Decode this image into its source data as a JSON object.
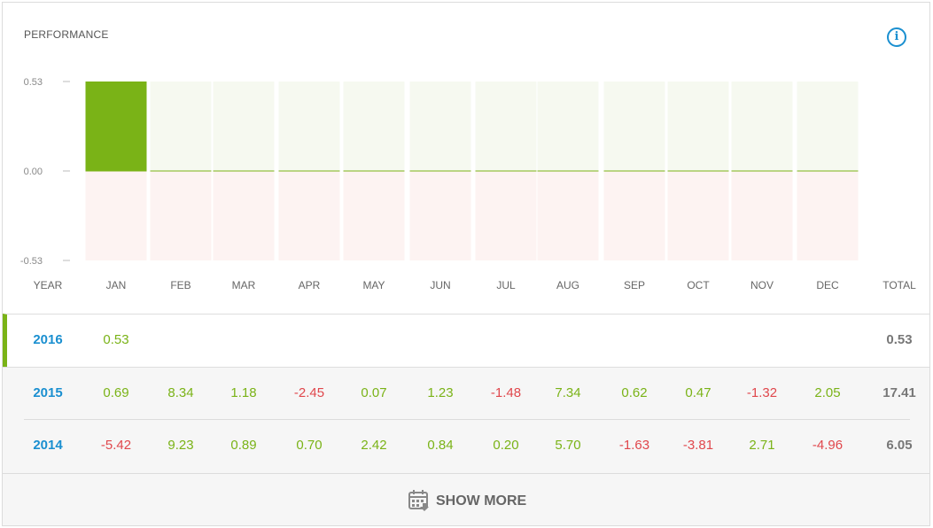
{
  "header": {
    "title": "PERFORMANCE",
    "info_icon": "info-icon"
  },
  "chart_data": {
    "type": "bar",
    "categories": [
      "JAN",
      "FEB",
      "MAR",
      "APR",
      "MAY",
      "JUN",
      "JUL",
      "AUG",
      "SEP",
      "OCT",
      "NOV",
      "DEC"
    ],
    "series": [
      {
        "values": [
          0.53,
          0,
          0,
          0,
          0,
          0,
          0,
          0,
          0,
          0,
          0,
          0
        ]
      }
    ],
    "ylim": [
      -0.53,
      0.53
    ],
    "yticks": [
      "0.53",
      "0.00",
      "-0.53"
    ],
    "colors": {
      "positive": "#7ab317",
      "positive_bg": "#f6f9f0",
      "negative_bg": "#fdf3f2"
    }
  },
  "table": {
    "columns": [
      "YEAR",
      "JAN",
      "FEB",
      "MAR",
      "APR",
      "MAY",
      "JUN",
      "JUL",
      "AUG",
      "SEP",
      "OCT",
      "NOV",
      "DEC",
      "TOTAL"
    ],
    "rows": [
      {
        "year": "2016",
        "months": [
          "0.53",
          "",
          "",
          "",
          "",
          "",
          "",
          "",
          "",
          "",
          "",
          ""
        ],
        "total": "0.53"
      },
      {
        "year": "2015",
        "months": [
          "0.69",
          "8.34",
          "1.18",
          "-2.45",
          "0.07",
          "1.23",
          "-1.48",
          "7.34",
          "0.62",
          "0.47",
          "-1.32",
          "2.05"
        ],
        "total": "17.41"
      },
      {
        "year": "2014",
        "months": [
          "-5.42",
          "9.23",
          "0.89",
          "0.70",
          "2.42",
          "0.84",
          "0.20",
          "5.70",
          "-1.63",
          "-3.81",
          "2.71",
          "-4.96"
        ],
        "total": "6.05"
      }
    ]
  },
  "footer": {
    "show_more_label": "SHOW MORE",
    "icon": "calendar-icon"
  }
}
